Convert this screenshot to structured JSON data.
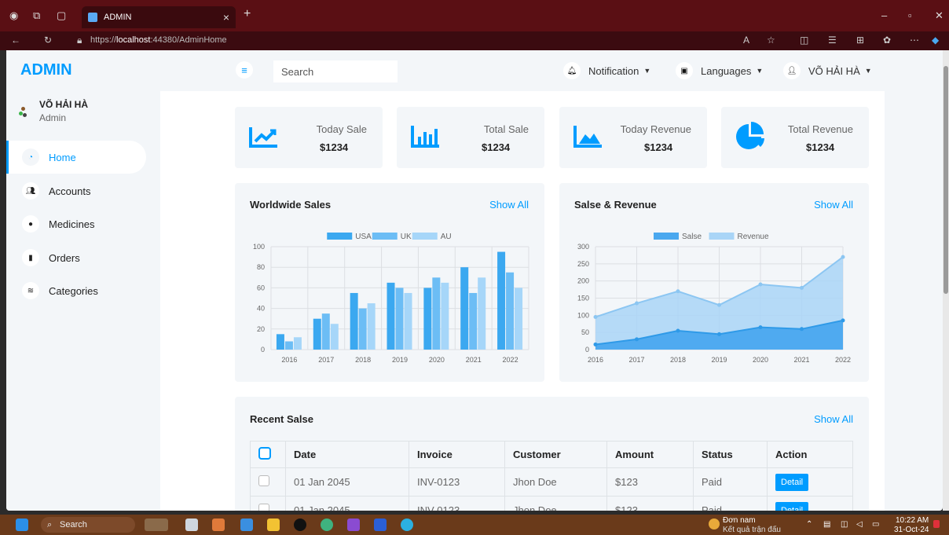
{
  "browser": {
    "tab_title": "ADMIN",
    "url_prefix": "https://",
    "url_host": "localhost",
    "url_rest": ":44380/AdminHome"
  },
  "sidebar": {
    "brand": "ADMIN",
    "user_name": "VÕ HẢI HÀ",
    "user_role": "Admin",
    "items": [
      {
        "label": "Home",
        "icon": "dashboard-icon"
      },
      {
        "label": "Accounts",
        "icon": "users-icon"
      },
      {
        "label": "Medicines",
        "icon": "pills-icon"
      },
      {
        "label": "Orders",
        "icon": "receipt-icon"
      },
      {
        "label": "Categories",
        "icon": "layers-icon"
      }
    ]
  },
  "topbar": {
    "search_placeholder": "Search",
    "notification": "Notification",
    "languages": "Languages",
    "user": "VÕ HẢI HÀ"
  },
  "stats": [
    {
      "label": "Today Sale",
      "value": "$1234",
      "icon": "line-chart-icon"
    },
    {
      "label": "Total Sale",
      "value": "$1234",
      "icon": "bar-chart-icon"
    },
    {
      "label": "Today Revenue",
      "value": "$1234",
      "icon": "area-chart-icon"
    },
    {
      "label": "Total Revenue",
      "value": "$1234",
      "icon": "pie-chart-icon"
    }
  ],
  "charts": {
    "worldwide_title": "Worldwide Sales",
    "sales_revenue_title": "Salse & Revenue",
    "show_all": "Show All"
  },
  "chart_data": [
    {
      "type": "bar",
      "title": "Worldwide Sales",
      "categories": [
        "2016",
        "2017",
        "2018",
        "2019",
        "2020",
        "2021",
        "2022"
      ],
      "series": [
        {
          "name": "USA",
          "values": [
            15,
            30,
            55,
            65,
            60,
            80,
            95
          ],
          "color": "#3ba8f0"
        },
        {
          "name": "UK",
          "values": [
            8,
            35,
            40,
            60,
            70,
            55,
            75
          ],
          "color": "#6cbdf5"
        },
        {
          "name": "AU",
          "values": [
            12,
            25,
            45,
            55,
            65,
            70,
            60
          ],
          "color": "#a6d6f9"
        }
      ],
      "ylim": [
        0,
        100
      ],
      "yticks": [
        0,
        20,
        40,
        60,
        80,
        100
      ],
      "legend": "top-center",
      "grid": true
    },
    {
      "type": "area",
      "title": "Salse & Revenue",
      "categories": [
        "2016",
        "2017",
        "2018",
        "2019",
        "2020",
        "2021",
        "2022"
      ],
      "series": [
        {
          "name": "Salse",
          "values": [
            15,
            30,
            55,
            45,
            65,
            60,
            85
          ],
          "color": "#4aa8ef"
        },
        {
          "name": "Revenue",
          "values": [
            95,
            135,
            170,
            130,
            190,
            180,
            270
          ],
          "color": "#a9d5f7"
        }
      ],
      "ylim": [
        0,
        300
      ],
      "yticks": [
        0,
        50,
        100,
        150,
        200,
        250,
        300
      ],
      "legend": "top-center",
      "grid": true
    }
  ],
  "recent": {
    "title": "Recent Salse",
    "show_all": "Show All",
    "columns": [
      "Date",
      "Invoice",
      "Customer",
      "Amount",
      "Status",
      "Action"
    ],
    "rows": [
      {
        "date": "01 Jan 2045",
        "invoice": "INV-0123",
        "customer": "Jhon Doe",
        "amount": "$123",
        "status": "Paid",
        "action": "Detail"
      },
      {
        "date": "01 Jan 2045",
        "invoice": "INV-0123",
        "customer": "Jhon Doe",
        "amount": "$123",
        "status": "Paid",
        "action": "Detail"
      }
    ]
  },
  "taskbar": {
    "search": "Search",
    "notify_title": "Đơn nam",
    "notify_sub": "Kết quả trận đấu",
    "time": "10:22 AM",
    "date": "31-Oct-24"
  }
}
